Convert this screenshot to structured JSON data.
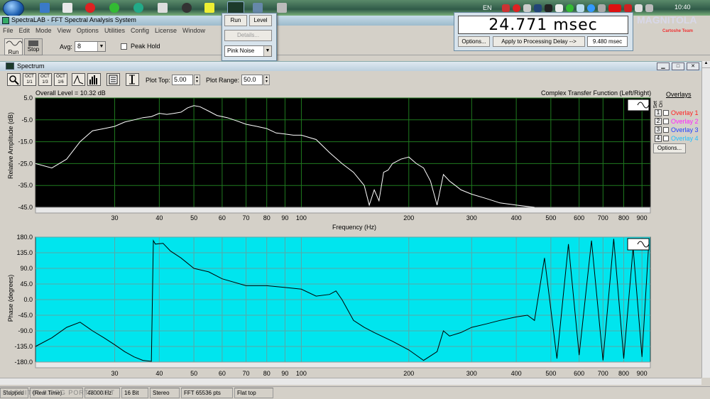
{
  "taskbar": {
    "lang": "EN",
    "clock": "10:40",
    "watermark_brand": "MAGNITOLA",
    "watermark_sub": "Cartoshe Team"
  },
  "window": {
    "title": "SpectraLAB - FFT Spectral Analysis System",
    "menus": [
      "File",
      "Edit",
      "Mode",
      "View",
      "Options",
      "Utilities",
      "Config",
      "License",
      "Window"
    ]
  },
  "toolbar": {
    "run_label": "Run",
    "stop_label": "Stop",
    "avg_label": "Avg:",
    "avg_value": "8",
    "peak_hold_label": "Peak Hold"
  },
  "generator": {
    "run_label": "Run",
    "level_label": "Level",
    "details_label": "Details...",
    "signal_value": "Pink Noise"
  },
  "delay": {
    "value": "24.771 msec",
    "options_label": "Options...",
    "apply_label": "Apply to Processing Delay -->",
    "processing_delay": "9.480 msec"
  },
  "spectrum": {
    "title": "Spectrum",
    "plot_top_label": "Plot Top:",
    "plot_top_value": "5.00",
    "plot_range_label": "Plot Range:",
    "plot_range_value": "50.0",
    "overall_level": "Overall Level = 10.32 dB",
    "mode_label": "Complex Transfer Function (Left/Right)",
    "overlays": {
      "title": "Overlays",
      "set_label": "Set",
      "on_label": "On",
      "items": [
        {
          "num": "1",
          "label": "Overlay 1",
          "color": "#ff2020"
        },
        {
          "num": "2",
          "label": "Overlay 2",
          "color": "#ff20ff"
        },
        {
          "num": "3",
          "label": "Overlay 3",
          "color": "#2040ff"
        },
        {
          "num": "4",
          "label": "Overlay 4",
          "color": "#20c0ff"
        }
      ],
      "options_label": "Options..."
    }
  },
  "status": {
    "items": [
      "Stopped",
      "(Real Time)",
      "48000 Hz",
      "16 Bit",
      "Stereo",
      "FFT 65536 pts",
      "Flat top"
    ],
    "watermark": "MAGNITOLA.ORG  PORTAL.NET"
  },
  "chart_data": [
    {
      "type": "line",
      "background": "#000000",
      "line_color": "#ffffff",
      "grid_color": "#1f7a1f",
      "xscale": "log",
      "xlim": [
        18,
        950
      ],
      "ylim": [
        -45,
        5
      ],
      "xlabel": "Frequency (Hz)",
      "ylabel": "Relative Amplitude (dB)",
      "xticks": [
        30,
        40,
        50,
        60,
        70,
        80,
        90,
        100,
        200,
        300,
        400,
        500,
        600,
        700,
        800,
        900
      ],
      "xtick_labels": [
        "30",
        "40",
        "50",
        "60",
        "70",
        "80",
        "90",
        "100",
        "200",
        "300",
        "400",
        "500",
        "600",
        "700",
        "800",
        "900"
      ],
      "yticks": [
        5,
        -5,
        -15,
        -25,
        -35,
        -45
      ],
      "ytick_labels": [
        "5.0",
        "-5.0",
        "-15.0",
        "-25.0",
        "-35.0",
        "-45.0"
      ],
      "series": [
        {
          "x": [
            18,
            20,
            22,
            24,
            26,
            28,
            30,
            32,
            34,
            36,
            38,
            40,
            42,
            44,
            46,
            48,
            50,
            52,
            55,
            58,
            62,
            66,
            70,
            75,
            80,
            85,
            90,
            95,
            100,
            110,
            120,
            130,
            140,
            150,
            155,
            160,
            165,
            170,
            175,
            180,
            190,
            200,
            210,
            220,
            230,
            240,
            250,
            260,
            270,
            280,
            300,
            330,
            360,
            400,
            450
          ],
          "y": [
            -25,
            -27,
            -23,
            -15,
            -10,
            -9,
            -8,
            -6,
            -5,
            -4,
            -3.5,
            -2,
            -2.5,
            -2,
            -1.5,
            0.5,
            1.5,
            1,
            -1,
            -3,
            -4,
            -5.5,
            -7,
            -8,
            -9,
            -11,
            -11.5,
            -12,
            -12,
            -14,
            -20,
            -25,
            -29,
            -35,
            -44,
            -37,
            -42,
            -29,
            -28,
            -25,
            -23,
            -22,
            -25,
            -27,
            -33,
            -44,
            -30,
            -33,
            -35,
            -37,
            -39,
            -41,
            -43,
            -44,
            -45
          ]
        }
      ]
    },
    {
      "type": "line",
      "background": "#00e5ee",
      "line_color": "#000000",
      "grid_color": "#5aa7a7",
      "xscale": "log",
      "xlim": [
        18,
        950
      ],
      "ylim": [
        -180,
        180
      ],
      "ylabel": "Phase (degrees)",
      "xticks": [
        30,
        40,
        50,
        60,
        70,
        80,
        90,
        100,
        200,
        300,
        400,
        500,
        600,
        700,
        800,
        900
      ],
      "xtick_labels": [
        "30",
        "40",
        "50",
        "60",
        "70",
        "80",
        "90",
        "100",
        "200",
        "300",
        "400",
        "500",
        "600",
        "700",
        "800",
        "900"
      ],
      "yticks": [
        180,
        135,
        90,
        45,
        0,
        -45,
        -90,
        -135,
        -180
      ],
      "ytick_labels": [
        "180.0",
        "135.0",
        "90.0",
        "45.0",
        "0.0",
        "-45.0",
        "-90.0",
        "-135.0",
        "-180.0"
      ],
      "series": [
        {
          "x": [
            18,
            20,
            22,
            24,
            26,
            28,
            30,
            32,
            34,
            36,
            38,
            38.5,
            39,
            41,
            43,
            46,
            50,
            55,
            60,
            70,
            80,
            90,
            100,
            110,
            120,
            125,
            130,
            140,
            150,
            160,
            180,
            200,
            220,
            240,
            250,
            260,
            280,
            300,
            330,
            360,
            400,
            430,
            450,
            480,
            520,
            560,
            600,
            650,
            700,
            750,
            800,
            850,
            900,
            940
          ],
          "y": [
            -135,
            -110,
            -80,
            -65,
            -90,
            -110,
            -130,
            -150,
            -165,
            -175,
            -178,
            170,
            160,
            162,
            140,
            120,
            90,
            80,
            60,
            40,
            40,
            35,
            30,
            10,
            15,
            25,
            0,
            -60,
            -80,
            -95,
            -120,
            -145,
            -175,
            -150,
            -90,
            -105,
            -95,
            -80,
            -70,
            -60,
            -50,
            -45,
            -60,
            120,
            -170,
            160,
            -160,
            170,
            -175,
            175,
            -170,
            150,
            -165,
            160
          ]
        }
      ]
    }
  ]
}
